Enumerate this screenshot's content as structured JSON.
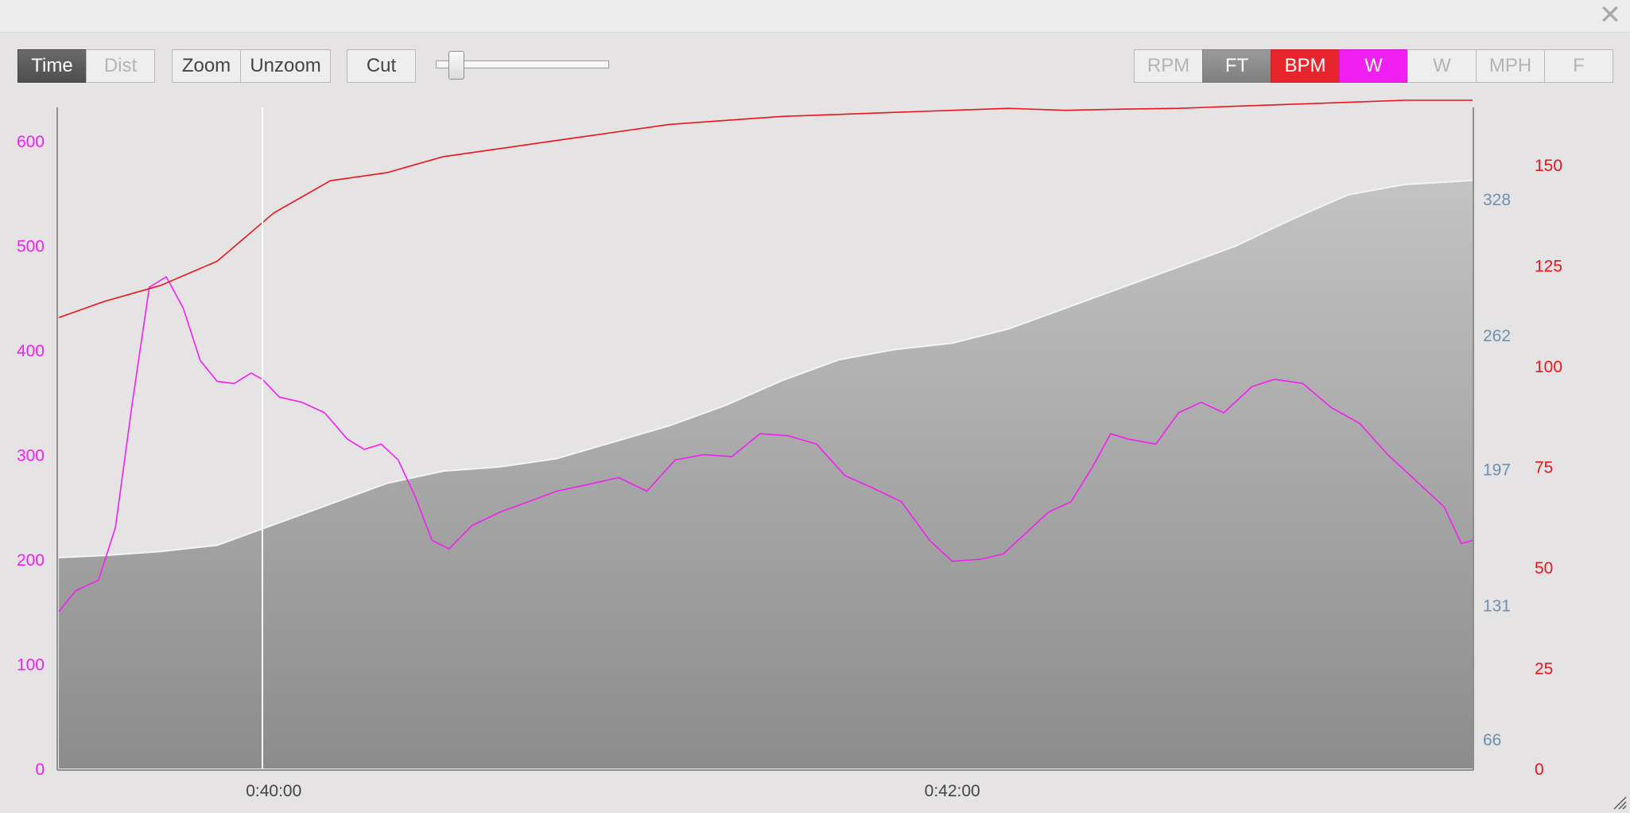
{
  "window": {
    "close_glyph": "✕"
  },
  "toolbar": {
    "mode_buttons": [
      {
        "label": "Time",
        "active": true
      },
      {
        "label": "Dist",
        "active": false
      }
    ],
    "zoom_buttons": [
      {
        "label": "Zoom"
      },
      {
        "label": "Unzoom"
      }
    ],
    "cut_label": "Cut",
    "series_buttons": [
      {
        "label": "RPM",
        "state": "inactive"
      },
      {
        "label": "FT",
        "state": "active"
      },
      {
        "label": "BPM",
        "state": "active"
      },
      {
        "label": "W",
        "state": "active"
      },
      {
        "label": "W",
        "state": "inactive"
      },
      {
        "label": "MPH",
        "state": "inactive"
      },
      {
        "label": "F",
        "state": "inactive"
      }
    ]
  },
  "colors": {
    "power": "#f21ff2",
    "heart_rate": "#e8151c",
    "elevation_axis": "#6f8fae",
    "area_top": "#c4c3c4",
    "area_bottom": "#8c8c8c"
  },
  "chart_data": {
    "type": "line",
    "x": [
      "0:39:22",
      "0:39:30",
      "0:39:40",
      "0:39:50",
      "0:40:00",
      "0:40:10",
      "0:40:20",
      "0:40:30",
      "0:40:40",
      "0:40:50",
      "0:41:00",
      "0:41:10",
      "0:41:20",
      "0:41:30",
      "0:41:40",
      "0:41:50",
      "0:42:00",
      "0:42:10",
      "0:42:20",
      "0:42:30"
    ],
    "x_range": [
      "0:39:22",
      "0:42:29"
    ],
    "x_ticks": [
      "0:40:00",
      "0:42:00"
    ],
    "cursor_x": "0:39:58",
    "series": [
      {
        "name": "W",
        "axis": "left",
        "points": [
          [
            "0:39:22",
            150
          ],
          [
            "0:39:25",
            170
          ],
          [
            "0:39:29",
            180
          ],
          [
            "0:39:32",
            230
          ],
          [
            "0:39:35",
            350
          ],
          [
            "0:39:38",
            460
          ],
          [
            "0:39:41",
            470
          ],
          [
            "0:39:44",
            440
          ],
          [
            "0:39:47",
            390
          ],
          [
            "0:39:50",
            370
          ],
          [
            "0:39:53",
            368
          ],
          [
            "0:39:56",
            378
          ],
          [
            "0:39:58",
            372
          ],
          [
            "0:40:01",
            355
          ],
          [
            "0:40:05",
            350
          ],
          [
            "0:40:09",
            340
          ],
          [
            "0:40:13",
            315
          ],
          [
            "0:40:16",
            305
          ],
          [
            "0:40:19",
            310
          ],
          [
            "0:40:22",
            295
          ],
          [
            "0:40:25",
            260
          ],
          [
            "0:40:28",
            218
          ],
          [
            "0:40:31",
            210
          ],
          [
            "0:40:35",
            232
          ],
          [
            "0:40:40",
            245
          ],
          [
            "0:40:45",
            255
          ],
          [
            "0:40:50",
            265
          ],
          [
            "0:40:56",
            272
          ],
          [
            "0:41:01",
            278
          ],
          [
            "0:41:06",
            265
          ],
          [
            "0:41:11",
            295
          ],
          [
            "0:41:16",
            300
          ],
          [
            "0:41:21",
            298
          ],
          [
            "0:41:26",
            320
          ],
          [
            "0:41:31",
            318
          ],
          [
            "0:41:36",
            310
          ],
          [
            "0:41:41",
            280
          ],
          [
            "0:41:46",
            268
          ],
          [
            "0:41:51",
            255
          ],
          [
            "0:41:56",
            218
          ],
          [
            "0:42:00",
            198
          ],
          [
            "0:42:05",
            200
          ],
          [
            "0:42:09",
            205
          ],
          [
            "0:42:13",
            225
          ],
          [
            "0:42:17",
            245
          ],
          [
            "0:42:21",
            255
          ],
          [
            "0:42:25",
            290
          ],
          [
            "0:42:28",
            320
          ],
          [
            "0:42:31",
            315
          ],
          [
            "0:42:36",
            310
          ],
          [
            "0:42:40",
            340
          ],
          [
            "0:42:44",
            350
          ],
          [
            "0:42:48",
            340
          ],
          [
            "0:42:53",
            365
          ],
          [
            "0:42:57",
            372
          ],
          [
            "0:43:02",
            368
          ],
          [
            "0:43:07",
            345
          ],
          [
            "0:43:12",
            330
          ],
          [
            "0:43:17",
            300
          ],
          [
            "0:43:22",
            275
          ],
          [
            "0:43:27",
            250
          ],
          [
            "0:43:30",
            215
          ],
          [
            "0:43:32",
            218
          ]
        ]
      },
      {
        "name": "BPM",
        "axis": "right",
        "points": [
          [
            "0:39:22",
            112
          ],
          [
            "0:39:30",
            116
          ],
          [
            "0:39:40",
            120
          ],
          [
            "0:39:50",
            126
          ],
          [
            "0:40:00",
            138
          ],
          [
            "0:40:10",
            146
          ],
          [
            "0:40:20",
            148
          ],
          [
            "0:40:30",
            152
          ],
          [
            "0:40:40",
            154
          ],
          [
            "0:40:50",
            156
          ],
          [
            "0:41:00",
            158
          ],
          [
            "0:41:10",
            160
          ],
          [
            "0:41:20",
            161
          ],
          [
            "0:41:30",
            162
          ],
          [
            "0:41:40",
            162.5
          ],
          [
            "0:41:50",
            163
          ],
          [
            "0:42:00",
            163.5
          ],
          [
            "0:42:10",
            164
          ],
          [
            "0:42:20",
            163.5
          ],
          [
            "0:42:30",
            163.8
          ],
          [
            "0:42:40",
            164
          ],
          [
            "0:42:50",
            164.5
          ],
          [
            "0:43:00",
            165
          ],
          [
            "0:43:10",
            165.5
          ],
          [
            "0:43:20",
            166
          ],
          [
            "0:43:32",
            166
          ]
        ]
      },
      {
        "name": "FT",
        "axis": "right2",
        "type": "area",
        "points": [
          [
            "0:39:22",
            154
          ],
          [
            "0:39:30",
            155
          ],
          [
            "0:39:40",
            157
          ],
          [
            "0:39:50",
            160
          ],
          [
            "0:40:00",
            170
          ],
          [
            "0:40:10",
            180
          ],
          [
            "0:40:20",
            190
          ],
          [
            "0:40:30",
            196
          ],
          [
            "0:40:40",
            198
          ],
          [
            "0:40:50",
            202
          ],
          [
            "0:41:00",
            210
          ],
          [
            "0:41:10",
            218
          ],
          [
            "0:41:20",
            228
          ],
          [
            "0:41:30",
            240
          ],
          [
            "0:41:40",
            250
          ],
          [
            "0:41:50",
            255
          ],
          [
            "0:42:00",
            258
          ],
          [
            "0:42:10",
            265
          ],
          [
            "0:42:20",
            275
          ],
          [
            "0:42:30",
            285
          ],
          [
            "0:42:40",
            295
          ],
          [
            "0:42:50",
            305
          ],
          [
            "0:43:00",
            318
          ],
          [
            "0:43:10",
            330
          ],
          [
            "0:43:20",
            335
          ],
          [
            "0:43:32",
            337
          ]
        ]
      }
    ],
    "left_axis": {
      "ticks": [
        "0",
        "100",
        "200",
        "300",
        "400",
        "500",
        "600"
      ],
      "range": [
        0,
        600
      ]
    },
    "right_axis": {
      "ticks": [
        "0",
        "25",
        "50",
        "75",
        "100",
        "125",
        "150"
      ],
      "range": [
        0,
        150
      ]
    },
    "right2_axis": {
      "ticks": [
        "66",
        "131",
        "197",
        "262",
        "328"
      ],
      "range": [
        66,
        328
      ]
    },
    "grid": false
  }
}
